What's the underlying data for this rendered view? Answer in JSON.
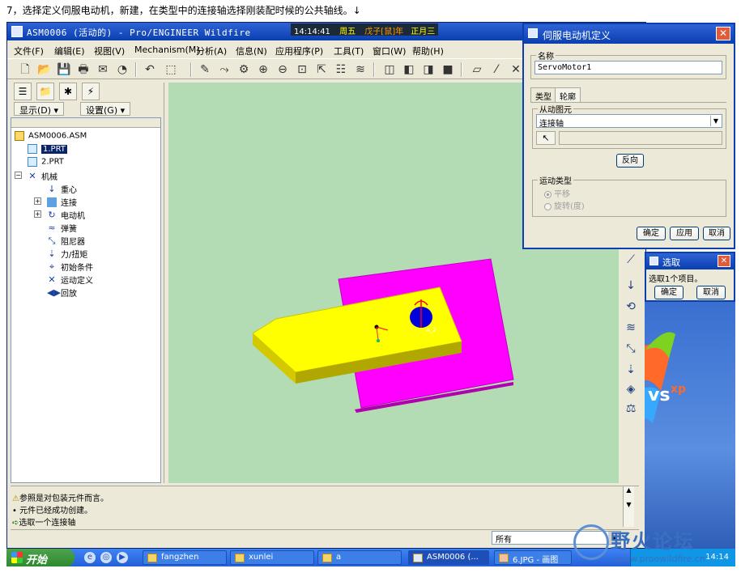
{
  "caption": "7，选择定义伺服电动机，新建，在类型中的连接轴选择刚装配时候的公共轴线。↓",
  "main_window": {
    "title": "ASM0006 (活动的) - Pro/ENGINEER Wildfire",
    "clock": {
      "time": "14:14:41",
      "weekday": "周五",
      "lunar": "戊子[鼠]年",
      "lunar_date": "正月三"
    },
    "menu": [
      "文件(F)",
      "编辑(E)",
      "视图(V)",
      "Mechanism(M)",
      "分析(A)",
      "信息(N)",
      "应用程序(P)",
      "工具(T)",
      "窗口(W)",
      "帮助(H)"
    ],
    "display_label": "显示(D)",
    "settings_label": "设置(G)",
    "tree": {
      "root": "ASM0006.ASM",
      "part1": "1.PRT",
      "part2": "2.PRT",
      "mechanism": "机械",
      "children": [
        "重心",
        "连接",
        "电动机",
        "弹簧",
        "阻尼器",
        "力/扭矩",
        "初始条件",
        "运动定义",
        "回放"
      ]
    },
    "messages": [
      "参照是对包装元件而言。",
      "• 元件已经成功创建。",
      "选取一个连接轴"
    ],
    "filter_value": "所有"
  },
  "servo_dialog": {
    "title": "伺服电动机定义",
    "name_label": "名称",
    "name_value": "ServoMotor1",
    "tabs": [
      "类型",
      "轮廓"
    ],
    "driven_label": "从动图元",
    "driven_value": "连接轴",
    "reverse_label": "反向",
    "motion_type_label": "运动类型",
    "translate_label": "平移",
    "rotate_label": "旋转(度)",
    "ok_label": "确定",
    "apply_label": "应用",
    "cancel_label": "取消"
  },
  "select_dialog": {
    "title": "选取",
    "message": "选取1个项目。",
    "ok_label": "确定",
    "cancel_label": "取消"
  },
  "taskbar": {
    "start_label": "开始",
    "tasks": [
      "fangzhen",
      "xunlei",
      "a",
      "ASM0006 (...",
      "6.JPG - 画图"
    ],
    "clock": "14:14"
  },
  "watermark": {
    "text": "野火论坛",
    "url": "www.proewildfire.cn"
  },
  "colors": {
    "graphics_bg": "#b4dcb4",
    "yellow_part": "#ffff00",
    "magenta_part": "#ff00ff",
    "title_blue": "#0a3fb0"
  }
}
